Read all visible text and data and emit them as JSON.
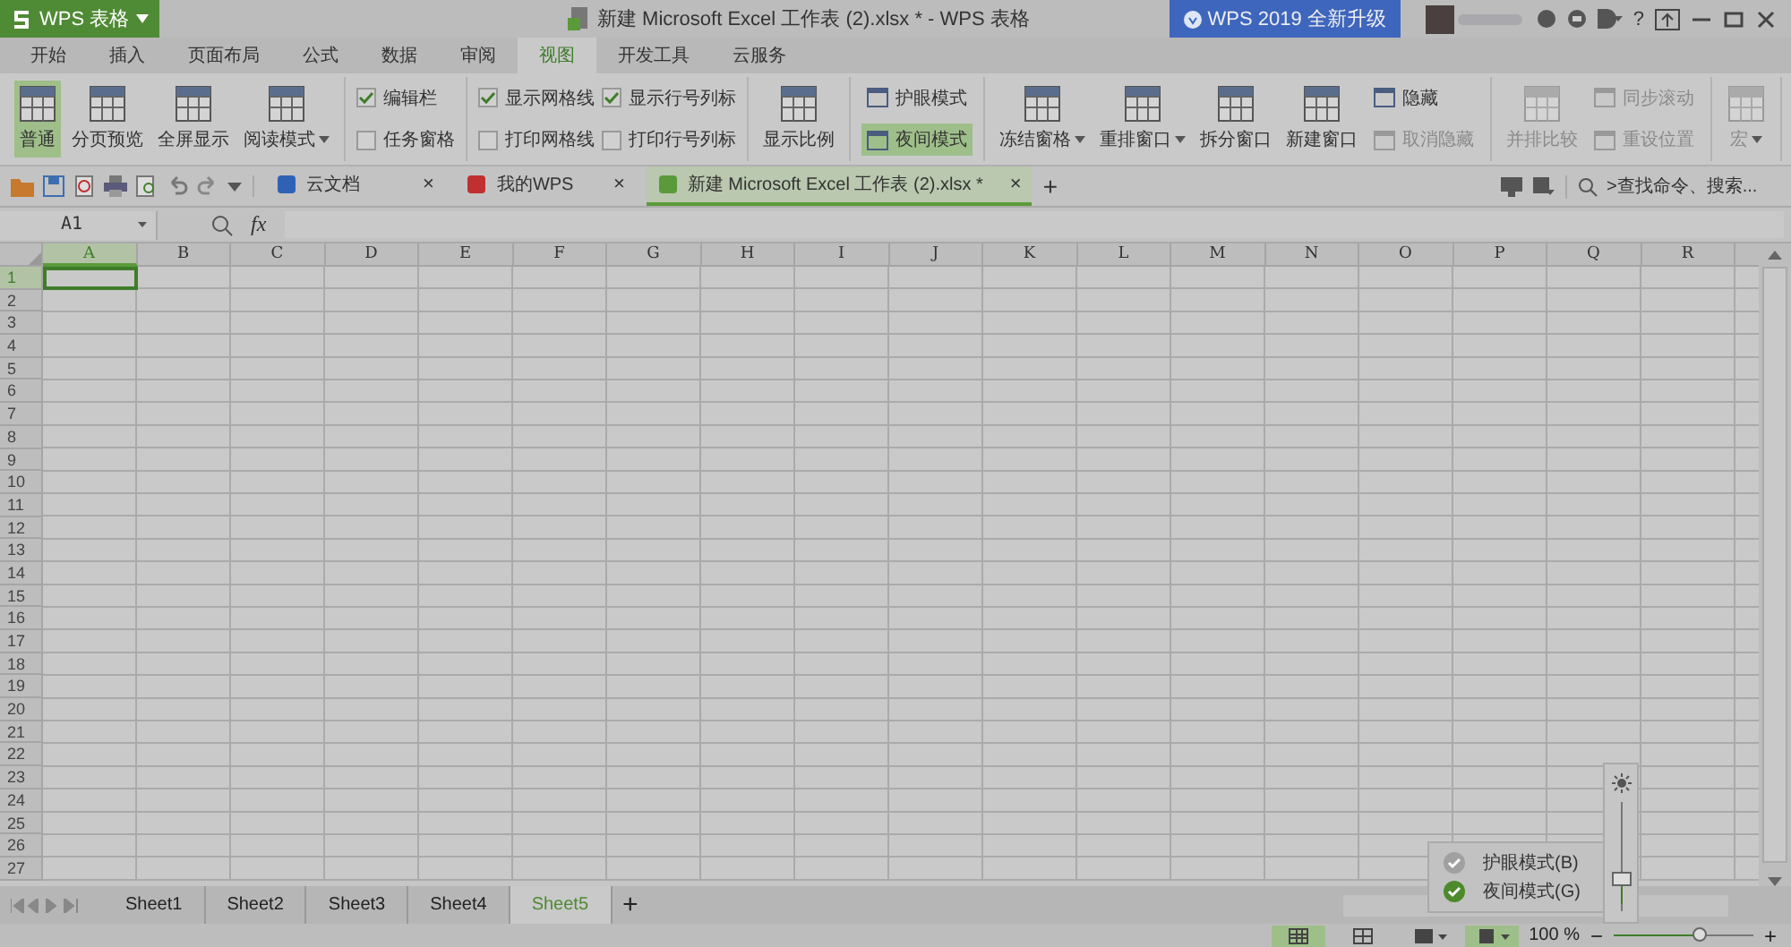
{
  "app_button": {
    "label": "WPS 表格"
  },
  "window": {
    "title": "新建 Microsoft Excel 工作表 (2).xlsx * - WPS 表格"
  },
  "upgrade_button": {
    "label": "WPS 2019 全新升级"
  },
  "help": {
    "label": "?"
  },
  "ribbon_tabs": [
    {
      "label": "开始",
      "selected": false
    },
    {
      "label": "插入",
      "selected": false
    },
    {
      "label": "页面布局",
      "selected": false
    },
    {
      "label": "公式",
      "selected": false
    },
    {
      "label": "数据",
      "selected": false
    },
    {
      "label": "审阅",
      "selected": false
    },
    {
      "label": "视图",
      "selected": true
    },
    {
      "label": "开发工具",
      "selected": false
    },
    {
      "label": "云服务",
      "selected": false
    }
  ],
  "ribbon": {
    "groups": [
      {
        "items": [
          {
            "kind": "large",
            "label": "普通",
            "selected": true,
            "dropdown": false,
            "disabled": false
          },
          {
            "kind": "large",
            "label": "分页预览",
            "selected": false,
            "dropdown": false,
            "disabled": false
          },
          {
            "kind": "large",
            "label": "全屏显示",
            "selected": false,
            "dropdown": false,
            "disabled": false
          },
          {
            "kind": "large",
            "label": "阅读模式",
            "selected": false,
            "dropdown": true,
            "disabled": false
          }
        ]
      },
      {
        "items": [
          {
            "kind": "check",
            "label": "编辑栏",
            "checked": true
          },
          {
            "kind": "check",
            "label": "任务窗格",
            "checked": false
          }
        ]
      },
      {
        "items": [
          {
            "kind": "check",
            "label": "显示网格线",
            "checked": true
          },
          {
            "kind": "check",
            "label": "打印网格线",
            "checked": false
          },
          {
            "kind": "check",
            "label": "显示行号列标",
            "checked": true
          },
          {
            "kind": "check",
            "label": "打印行号列标",
            "checked": false
          }
        ]
      },
      {
        "items": [
          {
            "kind": "large",
            "label": "显示比例",
            "selected": false,
            "dropdown": false,
            "disabled": false
          }
        ]
      },
      {
        "items": [
          {
            "kind": "small",
            "label": "护眼模式",
            "selected": false,
            "disabled": false
          },
          {
            "kind": "small",
            "label": "夜间模式",
            "selected": true,
            "disabled": false
          }
        ]
      },
      {
        "items": [
          {
            "kind": "large",
            "label": "冻结窗格",
            "selected": false,
            "dropdown": true,
            "disabled": false
          },
          {
            "kind": "large",
            "label": "重排窗口",
            "selected": false,
            "dropdown": true,
            "disabled": false
          },
          {
            "kind": "large",
            "label": "拆分窗口",
            "selected": false,
            "dropdown": false,
            "disabled": false
          },
          {
            "kind": "large",
            "label": "新建窗口",
            "selected": false,
            "dropdown": false,
            "disabled": false
          },
          {
            "kind": "small",
            "label": "隐藏",
            "selected": false,
            "disabled": false
          },
          {
            "kind": "small",
            "label": "取消隐藏",
            "selected": false,
            "disabled": true
          }
        ]
      },
      {
        "items": [
          {
            "kind": "large",
            "label": "并排比较",
            "selected": false,
            "dropdown": false,
            "disabled": true
          },
          {
            "kind": "small",
            "label": "同步滚动",
            "selected": false,
            "disabled": true
          },
          {
            "kind": "small",
            "label": "重设位置",
            "selected": false,
            "disabled": true
          }
        ]
      },
      {
        "items": [
          {
            "kind": "large",
            "label": "宏",
            "selected": false,
            "dropdown": true,
            "disabled": true
          }
        ]
      }
    ]
  },
  "doc_tabs": [
    {
      "label": "云文档",
      "close": "×",
      "selected": false
    },
    {
      "label": "我的WPS",
      "close": "×",
      "selected": false
    },
    {
      "label": "新建 Microsoft Excel 工作表 (2).xlsx *",
      "close": "×",
      "selected": true
    }
  ],
  "new_tab": "+",
  "search": {
    "placeholder": ">查找命令、搜索..."
  },
  "formula_bar": {
    "name_box": "A1",
    "fx": "fx"
  },
  "sheet": {
    "columns": [
      "A",
      "B",
      "C",
      "D",
      "E",
      "F",
      "G",
      "H",
      "I",
      "J",
      "K",
      "L",
      "M",
      "N",
      "O",
      "P",
      "Q",
      "R"
    ],
    "rows": [
      "1",
      "2",
      "3",
      "4",
      "5",
      "6",
      "7",
      "8",
      "9",
      "10",
      "11",
      "12",
      "13",
      "14",
      "15",
      "16",
      "17",
      "18",
      "19",
      "20",
      "21",
      "22",
      "23",
      "24",
      "25",
      "26",
      "27"
    ]
  },
  "sheet_tabs": [
    {
      "label": "Sheet1",
      "selected": false
    },
    {
      "label": "Sheet2",
      "selected": false
    },
    {
      "label": "Sheet3",
      "selected": false
    },
    {
      "label": "Sheet4",
      "selected": false
    },
    {
      "label": "Sheet5",
      "selected": true
    }
  ],
  "add_sheet": "+",
  "status_bar": {
    "zoom": "100 %",
    "zoom_out": "−",
    "zoom_in": "+",
    "zoom_slider": {
      "level": 0.62
    }
  },
  "eye_menu": {
    "items": [
      {
        "label": "护眼模式(B)",
        "checked": false
      },
      {
        "label": "夜间模式(G)",
        "checked": true
      }
    ],
    "brightness": {
      "level": 0.3
    }
  }
}
